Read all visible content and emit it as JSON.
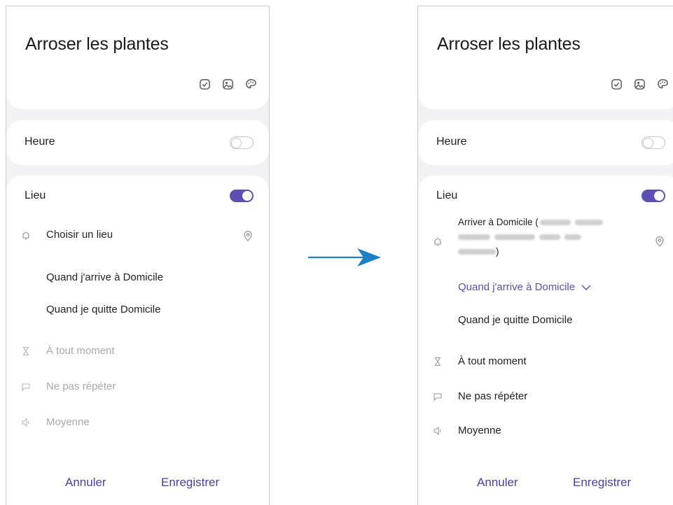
{
  "colors": {
    "accent": "#5b4fb3",
    "arrow": "#1d7fc4",
    "muted": "#a9a9a9"
  },
  "left": {
    "title": "Arroser les plantes",
    "toolbar_icons": [
      "checkbox-icon",
      "image-icon",
      "palette-icon"
    ],
    "heure": {
      "label": "Heure",
      "toggle_on": false
    },
    "lieu": {
      "label": "Lieu",
      "toggle_on": true,
      "choose_place": "Choisir un lieu",
      "option_arrive": "Quand j'arrive à Domicile",
      "option_leave": "Quand je quitte Domicile",
      "time": "À tout moment",
      "repeat": "Ne pas répéter",
      "priority": "Moyenne"
    },
    "cancel": "Annuler",
    "save": "Enregistrer"
  },
  "right": {
    "title": "Arroser les plantes",
    "toolbar_icons": [
      "checkbox-icon",
      "image-icon",
      "palette-icon"
    ],
    "heure": {
      "label": "Heure",
      "toggle_on": false
    },
    "lieu": {
      "label": "Lieu",
      "toggle_on": true,
      "arrive_prefix": "Arriver à Domicile (",
      "arrive_suffix": ")",
      "option_arrive_selected": "Quand j'arrive à Domicile",
      "option_leave": "Quand je quitte Domicile",
      "time": "À tout moment",
      "repeat": "Ne pas répéter",
      "priority": "Moyenne"
    },
    "cancel": "Annuler",
    "save": "Enregistrer"
  }
}
